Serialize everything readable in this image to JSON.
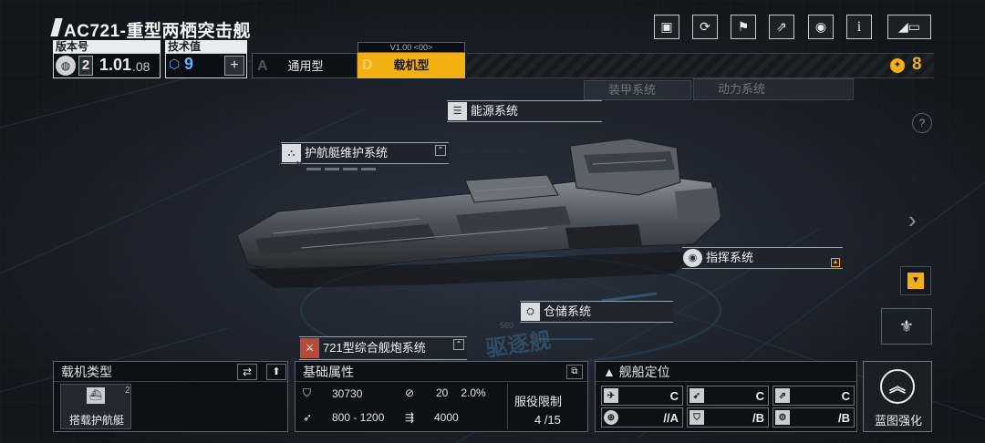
{
  "header": {
    "title": "AC721-重型两栖突击舰",
    "version_label": "版本号",
    "version_tier": "2",
    "version_number": "1.01",
    "version_sub": ".08",
    "tech_label": "技术值",
    "tech_value": "9",
    "tech_add": "+",
    "mode_version": "V1.00 <00>",
    "modes": [
      {
        "letter": "A",
        "label": "通用型",
        "active": false
      },
      {
        "letter": "D",
        "label": "载机型",
        "active": true
      }
    ],
    "currency_value": "8"
  },
  "toolbar": {
    "icons": [
      "gallery-icon",
      "refresh-icon",
      "flag-icon",
      "share-icon",
      "view-icon",
      "info-icon",
      "back-icon"
    ],
    "info_glyph": "i"
  },
  "faded_tabs": [
    "装甲系统",
    "动力系统"
  ],
  "help_glyph": "?",
  "callouts": {
    "energy": "能源系统",
    "escort": "护航艇维护系统",
    "command": "指挥系统",
    "storage": "仓储系统",
    "cannon": "721型综合舰炮系统",
    "escort_badge": "M"
  },
  "watermark": "驱逐舰",
  "hull_number": "560",
  "carrier": {
    "title": "载机类型",
    "item_label": "搭载护航艇",
    "item_count": "2"
  },
  "attributes": {
    "title": "基础属性",
    "hp": "30730",
    "range": "800 - 1200",
    "armor": "20",
    "armor_pct": "2.0%",
    "speed": "4000",
    "limit_label": "服役限制",
    "limit_value": "4 /15"
  },
  "positioning": {
    "title": "舰船定位",
    "grades": [
      "C",
      "C",
      "C",
      "//A",
      "/B",
      "/B"
    ]
  },
  "blueprint_label": "蓝图强化"
}
